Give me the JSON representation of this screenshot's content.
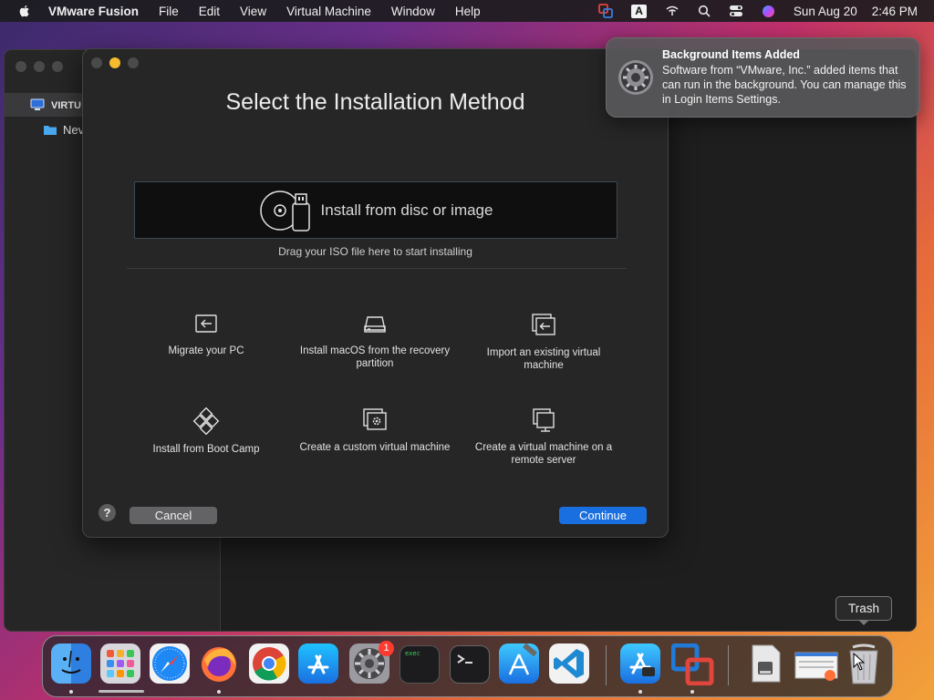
{
  "menubar": {
    "app_name": "VMware Fusion",
    "items": [
      "File",
      "Edit",
      "View",
      "Virtual Machine",
      "Window",
      "Help"
    ],
    "keyboard_indicator": "A",
    "date": "Sun Aug 20",
    "time": "2:46 PM"
  },
  "library": {
    "root_label": "VIRTU",
    "child_label": "Nev"
  },
  "dialog": {
    "title": "Select the Installation Method",
    "drop_zone_label": "Install from disc or image",
    "drop_hint": "Drag your ISO file here to start installing",
    "options": [
      {
        "label": "Migrate your PC",
        "icon": "migrate-icon"
      },
      {
        "label": "Install macOS from the recovery partition",
        "icon": "drive-icon"
      },
      {
        "label": "Import an existing virtual machine",
        "icon": "import-icon"
      },
      {
        "label": "Install from Boot Camp",
        "icon": "bootcamp-icon"
      },
      {
        "label": "Create a custom virtual machine",
        "icon": "custom-vm-icon"
      },
      {
        "label": "Create a virtual machine on a remote server",
        "icon": "remote-vm-icon"
      }
    ],
    "help_label": "?",
    "cancel_label": "Cancel",
    "continue_label": "Continue"
  },
  "notification": {
    "title": "Background Items Added",
    "body": "Software from “VMware, Inc.” added items that can run in the background. You can manage this in Login Items Settings."
  },
  "dock": {
    "tooltip": "Trash",
    "settings_badge": "1",
    "terminal_exec_label": "exec"
  },
  "colors": {
    "accent": "#1a6fe0",
    "dialog_bg": "#262626",
    "notification_bg": "#58585a"
  }
}
